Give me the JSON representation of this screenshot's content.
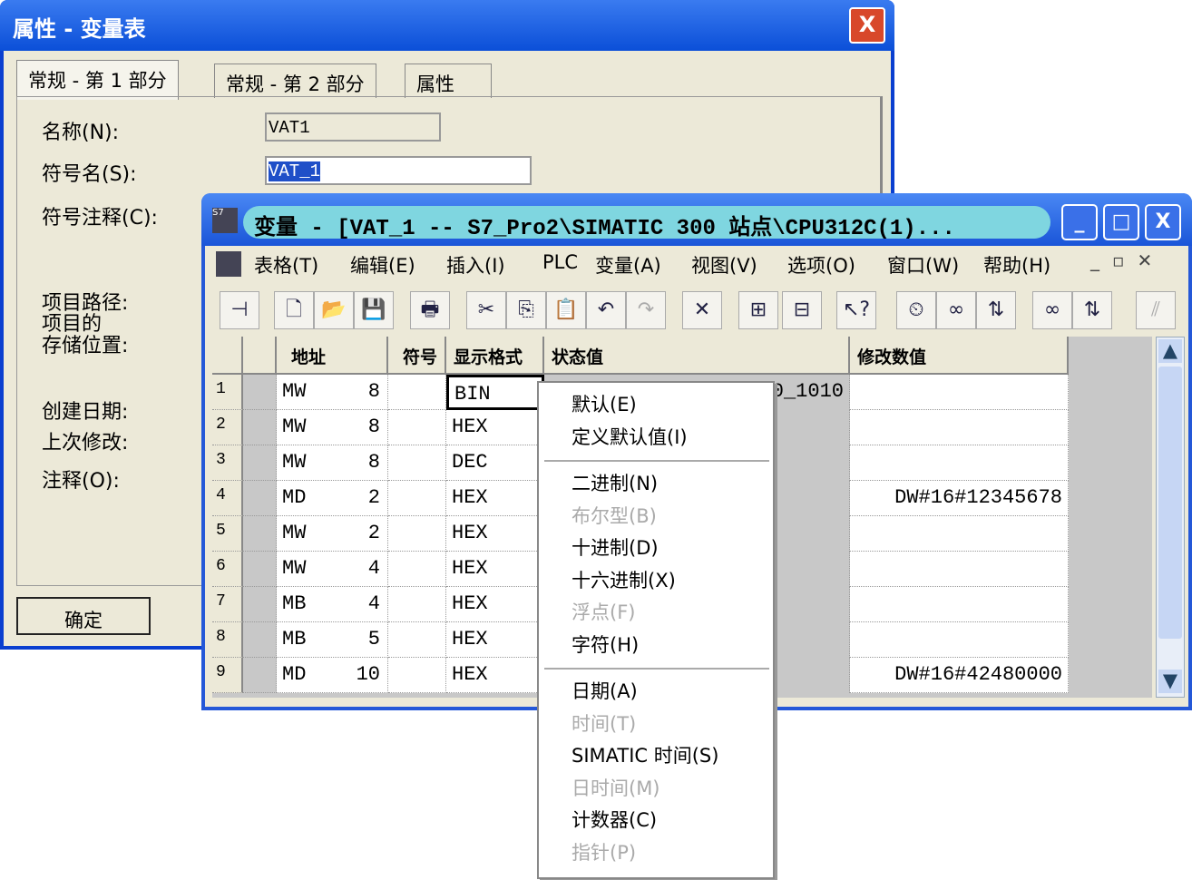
{
  "dialog": {
    "title": "属性 - 变量表",
    "tabs": [
      "常规 - 第 1 部分",
      "常规 - 第 2 部分",
      "属性"
    ],
    "fields": {
      "name_label": "名称(N):",
      "name_value": "VAT1",
      "symbol_label": "符号名(S):",
      "symbol_value": "VAT_1",
      "comment_label": "符号注释(C):",
      "path_label": "项目路径:",
      "storage_label": "项目的\n存储位置:",
      "created_label": "创建日期:",
      "modified_label": "上次修改:",
      "note_label": "注释(O):"
    },
    "ok": "确定",
    "close": "X"
  },
  "window": {
    "title": "变量 - [VAT_1 -- S7_Pro2\\SIMATIC 300 站点\\CPU312C(1)...",
    "menu": [
      "表格(T)",
      "编辑(E)",
      "插入(I)",
      "PLC",
      "变量(A)",
      "视图(V)",
      "选项(O)",
      "窗口(W)",
      "帮助(H)"
    ],
    "columns": [
      "地址",
      "符号",
      "显示格式",
      "状态值",
      "修改数值"
    ],
    "rows": [
      {
        "n": "1",
        "op": "MW",
        "addr": "8",
        "sym": "",
        "fmt": "BIN",
        "status": "2#0000_0001_0010_1010",
        "mod": ""
      },
      {
        "n": "2",
        "op": "MW",
        "addr": "8",
        "sym": "",
        "fmt": "HEX",
        "status": "",
        "mod": ""
      },
      {
        "n": "3",
        "op": "MW",
        "addr": "8",
        "sym": "",
        "fmt": "DEC",
        "status": "",
        "mod": ""
      },
      {
        "n": "4",
        "op": "MD",
        "addr": "2",
        "sym": "",
        "fmt": "HEX",
        "status": "",
        "mod": "DW#16#12345678"
      },
      {
        "n": "5",
        "op": "MW",
        "addr": "2",
        "sym": "",
        "fmt": "HEX",
        "status": "",
        "mod": ""
      },
      {
        "n": "6",
        "op": "MW",
        "addr": "4",
        "sym": "",
        "fmt": "HEX",
        "status": "",
        "mod": ""
      },
      {
        "n": "7",
        "op": "MB",
        "addr": "4",
        "sym": "",
        "fmt": "HEX",
        "status": "",
        "mod": ""
      },
      {
        "n": "8",
        "op": "MB",
        "addr": "5",
        "sym": "",
        "fmt": "HEX",
        "status": "",
        "mod": ""
      },
      {
        "n": "9",
        "op": "MD",
        "addr": "10",
        "sym": "",
        "fmt": "HEX",
        "status": "",
        "mod": "DW#16#42480000"
      }
    ]
  },
  "context_menu": [
    {
      "label": "默认(E)",
      "enabled": true
    },
    {
      "label": "定义默认值(I)",
      "enabled": true
    },
    {
      "sep": true
    },
    {
      "label": "二进制(N)",
      "enabled": true
    },
    {
      "label": "布尔型(B)",
      "enabled": false
    },
    {
      "label": "十进制(D)",
      "enabled": true
    },
    {
      "label": "十六进制(X)",
      "enabled": true
    },
    {
      "label": "浮点(F)",
      "enabled": false
    },
    {
      "label": "字符(H)",
      "enabled": true
    },
    {
      "sep": true
    },
    {
      "label": "日期(A)",
      "enabled": true
    },
    {
      "label": "时间(T)",
      "enabled": false
    },
    {
      "label": "SIMATIC 时间(S)",
      "enabled": true
    },
    {
      "label": "日时间(M)",
      "enabled": false
    },
    {
      "label": "计数器(C)",
      "enabled": true
    },
    {
      "label": "指针(P)",
      "enabled": false
    }
  ]
}
